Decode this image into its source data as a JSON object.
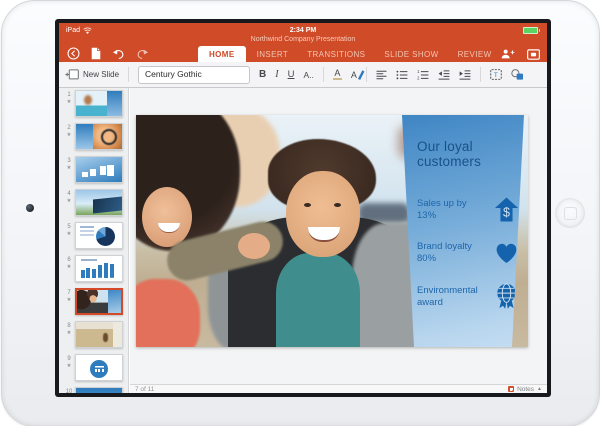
{
  "status_bar": {
    "carrier": "iPad",
    "time": "2:34 PM",
    "battery_level": "full"
  },
  "title_bar": {
    "document_title": "Northwind Company Presentation"
  },
  "ribbon": {
    "active_tab": "HOME",
    "tabs": [
      {
        "label": "HOME"
      },
      {
        "label": "INSERT"
      },
      {
        "label": "TRANSITIONS"
      },
      {
        "label": "SLIDE SHOW"
      },
      {
        "label": "REVIEW"
      }
    ]
  },
  "toolbar": {
    "new_slide_label": "New Slide",
    "font_name": "Century Gothic",
    "bold_label": "B",
    "italic_label": "I",
    "underline_label": "U",
    "font_size_label": "A..",
    "font_color_label": "A",
    "text_effects_label": "A"
  },
  "sidebar": {
    "selected_slide": 7,
    "slides": [
      {
        "num": "1"
      },
      {
        "num": "2"
      },
      {
        "num": "3"
      },
      {
        "num": "4"
      },
      {
        "num": "5"
      },
      {
        "num": "6"
      },
      {
        "num": "7"
      },
      {
        "num": "8"
      },
      {
        "num": "9"
      },
      {
        "num": "10"
      }
    ]
  },
  "slide": {
    "title": "Our loyal customers",
    "bullets": [
      {
        "label": "Sales up by 13%",
        "icon": "dollar-arrow-icon"
      },
      {
        "label": "Brand loyalty 80%",
        "icon": "heart-icon"
      },
      {
        "label": "Environmental award",
        "icon": "globe-award-icon"
      }
    ]
  },
  "footer": {
    "page_indicator": "7 of 11",
    "notes_label": "Notes"
  },
  "icons": {
    "wifi-icon": "wifi fan arcs",
    "battery-icon": "green rounded rect",
    "back-icon": "circled left arrow",
    "file-icon": "document sheet",
    "undo-icon": "curved arrow left",
    "redo-icon": "curved arrow right",
    "share-icon": "person with plus",
    "present-icon": "monitor with slide",
    "new-slide-icon": "slide with plus",
    "animation-star-icon": "star",
    "notes-icon": "orange note square",
    "dollar-arrow-icon": "up arrow with dollar sign",
    "heart-icon": "heart",
    "globe-award-icon": "globe with award ribbons"
  },
  "colors": {
    "ribbon_orange": "#d04b28",
    "selection_orange": "#d44a28",
    "panel_blue_dark": "#3e85c4",
    "panel_blue_light": "#c4ddf2",
    "accent_blue": "#1463ac",
    "panel_text_blue": "#1a5189",
    "battery_green": "#5bd463"
  }
}
